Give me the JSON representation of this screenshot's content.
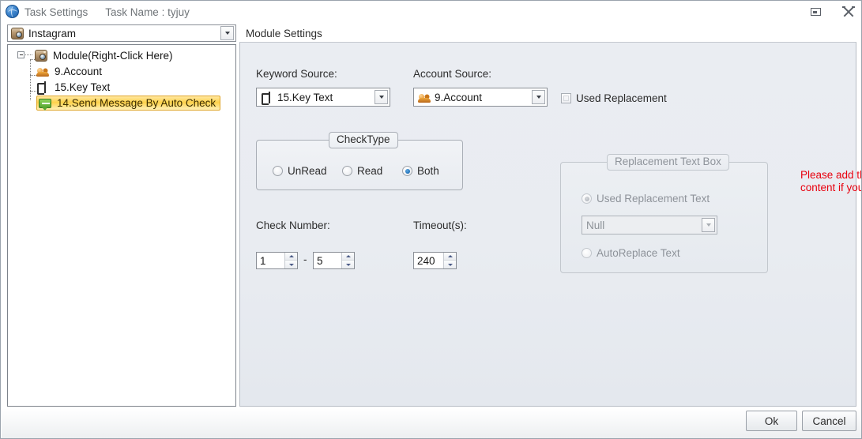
{
  "window": {
    "title": "Task Settings",
    "task_name": "Task Name : tyjuy",
    "restore_icon": "restore-icon",
    "close_icon": "close-icon",
    "app_icon": "globe-icon"
  },
  "platform_combo": {
    "value": "Instagram",
    "icon": "instagram-icon"
  },
  "tree": {
    "nodes": [
      {
        "label": "Module(Right-Click Here)",
        "icon": "instagram-icon",
        "level": 0,
        "selected": false
      },
      {
        "label": "9.Account",
        "icon": "people-icon",
        "level": 1,
        "selected": false
      },
      {
        "label": "15.Key Text",
        "icon": "key-text-icon",
        "level": 1,
        "selected": false
      },
      {
        "label": "14.Send Message By Auto Check",
        "icon": "message-bubble-icon",
        "level": 1,
        "selected": true
      }
    ]
  },
  "settings": {
    "header": "Module Settings",
    "keyword_source": {
      "label": "Keyword Source:",
      "value": "15.Key Text",
      "icon": "key-text-icon"
    },
    "account_source": {
      "label": "Account Source:",
      "value": "9.Account",
      "icon": "people-icon"
    },
    "used_replacement": {
      "label": "Used  Replacement",
      "checked": false
    },
    "warning": "Please add this [UserName] in your content if you want to use this function.",
    "warning_color": "#e8000d",
    "check_type": {
      "caption": "CheckType",
      "options": [
        {
          "label": "UnRead",
          "selected": false
        },
        {
          "label": "Read",
          "selected": false
        },
        {
          "label": "Both",
          "selected": true
        }
      ]
    },
    "check_number": {
      "label": "Check Number:",
      "min": "1",
      "max": "5",
      "separator": "-"
    },
    "timeout": {
      "label": "Timeout(s):",
      "value": "240"
    },
    "replacement_box": {
      "caption": "Replacement Text Box",
      "enabled": false,
      "options": [
        {
          "label": "Used Replacement Text",
          "selected": true
        },
        {
          "label": "AutoReplace Text",
          "selected": false
        }
      ],
      "dropdown_value": "Null"
    }
  },
  "footer": {
    "ok_label": "Ok",
    "cancel_label": "Cancel"
  }
}
